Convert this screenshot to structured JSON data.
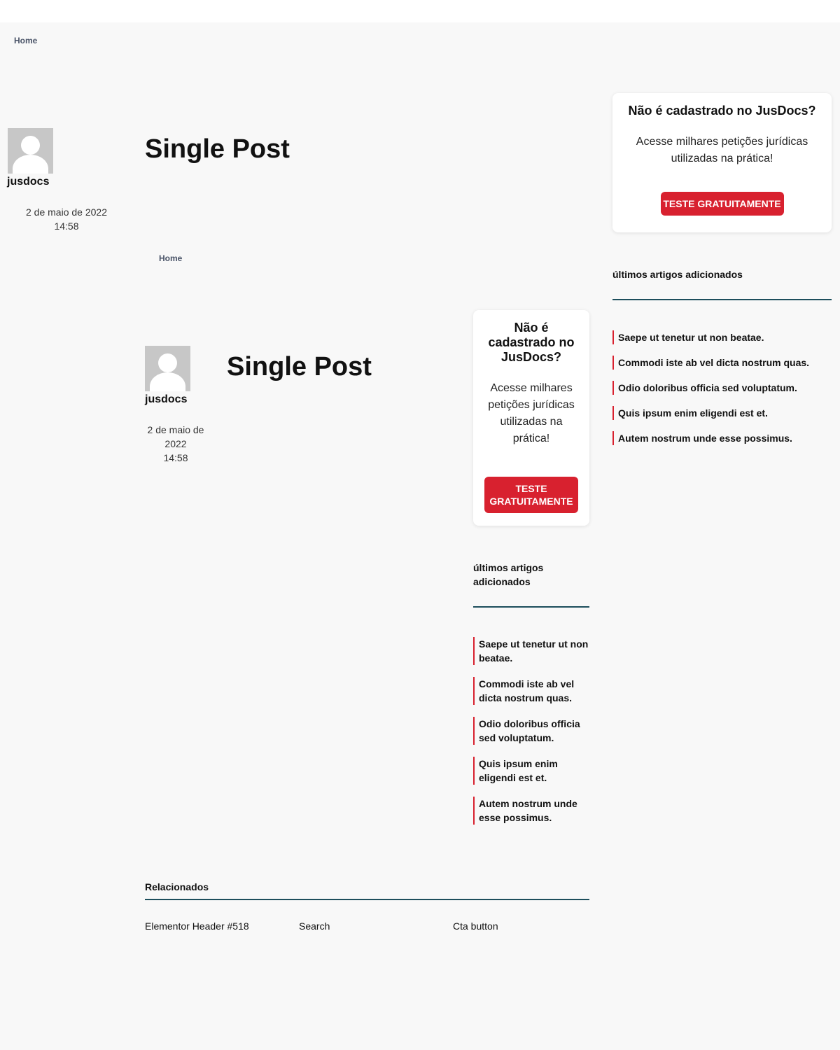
{
  "breadcrumb": {
    "home_label": "Home"
  },
  "post": {
    "author": "jusdocs",
    "date": "2 de maio de 2022",
    "time": "14:58",
    "title": "Single Post"
  },
  "cta": {
    "title": "Não é cadastrado no JusDocs?",
    "text": "Acesse milhares petições jurídicas utilizadas na prática!",
    "button_label": "TESTE GRATUITAMENTE"
  },
  "recent": {
    "title": "últimos artigos adicionados",
    "items": [
      "Saepe ut tenetur ut non beatae.",
      "Commodi iste ab vel dicta nostrum quas.",
      "Odio doloribus officia sed voluptatum.",
      "Quis ipsum enim eligendi est et.",
      "Autem nostrum unde esse possimus."
    ]
  },
  "related": {
    "title": "Relacionados",
    "items": [
      "Elementor Header #518",
      "Search",
      "Cta button"
    ]
  },
  "colors": {
    "accent_red": "#d8212f",
    "divider_teal": "#1d4e5c",
    "page_bg": "#f8f8f8"
  }
}
